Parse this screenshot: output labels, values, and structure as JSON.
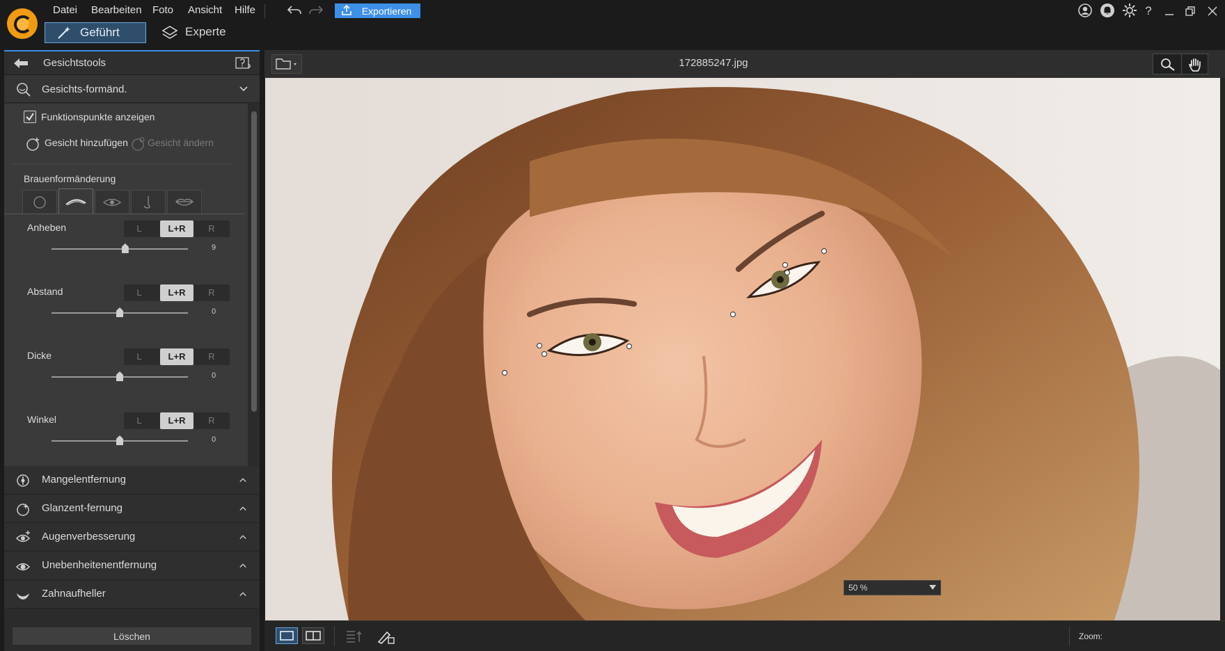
{
  "menu": {
    "datei": "Datei",
    "bearbeiten": "Bearbeiten",
    "foto": "Foto",
    "ansicht": "Ansicht",
    "hilfe": "Hilfe"
  },
  "toolbar": {
    "export_label": "Exportieren",
    "help_glyph": "?"
  },
  "modes": {
    "gefuehrt": "Geführt",
    "experte": "Experte"
  },
  "panel": {
    "header_title": "Gesichtstools",
    "face_section": "Gesichts-formänd.",
    "show_points": "Funktionspunkte anzeigen",
    "add_face": "Gesicht hinzufügen",
    "edit_face": "Gesicht ändern",
    "sub_title": "Brauenformänderung",
    "seg": {
      "l": "L",
      "lr": "L+R",
      "r": "R"
    },
    "sliders": [
      {
        "label": "Anheben",
        "value": "9",
        "level": 0.54
      },
      {
        "label": "Abstand",
        "value": "0",
        "level": 0.5
      },
      {
        "label": "Dicke",
        "value": "0",
        "level": 0.5
      },
      {
        "label": "Winkel",
        "value": "0",
        "level": 0.5
      }
    ],
    "sections": [
      {
        "label": "Mangelentfernung",
        "icon": "blemish-icon"
      },
      {
        "label": "Glanzent-fernung",
        "icon": "shine-icon"
      },
      {
        "label": "Augenverbesserung",
        "icon": "eye-plus-icon"
      },
      {
        "label": "Unebenheitenentfernung",
        "icon": "eye-icon"
      },
      {
        "label": "Zahnaufheller",
        "icon": "tooth-icon"
      }
    ],
    "delete_label": "Löschen"
  },
  "viewer": {
    "filename": "172885247.jpg",
    "zoom_label": "Zoom:",
    "zoom_value": "50 %"
  },
  "colors": {
    "accent": "#3d8fe8",
    "logo": "#f29a10"
  }
}
